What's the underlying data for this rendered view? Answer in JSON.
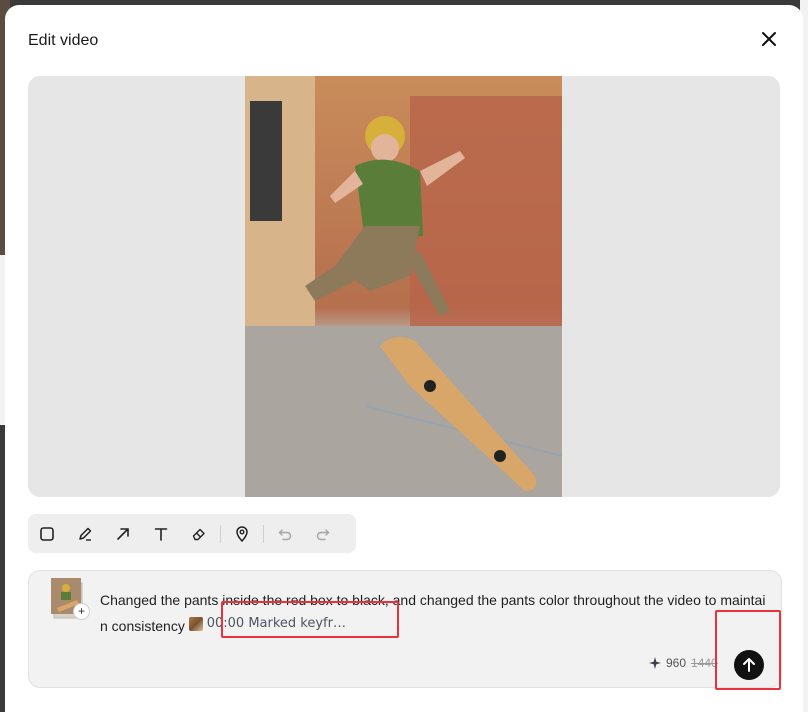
{
  "dialog": {
    "title": "Edit video"
  },
  "toolbar": {
    "tools": [
      "rectangle-icon",
      "pen-icon",
      "arrow-icon",
      "text-icon",
      "eraser-icon",
      "location-pin-icon",
      "undo-icon",
      "redo-icon"
    ]
  },
  "prompt": {
    "text": "Changed the pants inside the red box to black, and changed the pants color throughout the video to maintain consistency",
    "keyframe_label": "00:00 Marked keyfr…",
    "thumb_add": "+"
  },
  "credits": {
    "current": "960",
    "original": "1440"
  },
  "colors": {
    "accent_highlight": "#e8323c",
    "send_button": "#111111"
  }
}
